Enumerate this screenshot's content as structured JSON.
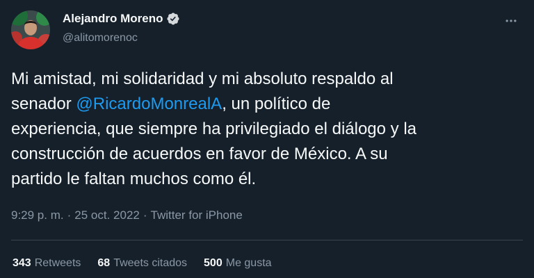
{
  "author": {
    "name": "Alejandro Moreno",
    "handle": "@alitomorenoc",
    "verified": true,
    "avatar_icon": "profile-photo"
  },
  "more_icon": "more-dots-icon",
  "tweet": {
    "lines": [
      [
        {
          "text": "Mi amistad, mi solidaridad y mi absoluto respaldo al"
        }
      ],
      [
        {
          "text": "senador "
        },
        {
          "text": "@RicardoMonrealA",
          "mention": true
        },
        {
          "text": ", un político de"
        }
      ],
      [
        {
          "text": "experiencia, que siempre ha privilegiado el diálogo y la"
        }
      ],
      [
        {
          "text": "construcción de acuerdos en favor de México. A su"
        }
      ],
      [
        {
          "text": "partido le faltan muchos como él."
        }
      ]
    ]
  },
  "meta": {
    "time": "9:29 p. m.",
    "separator": "·",
    "date": "25 oct. 2022",
    "source": "Twitter for iPhone"
  },
  "stats": [
    {
      "count": "343",
      "label": "Retweets"
    },
    {
      "count": "68",
      "label": "Tweets citados"
    },
    {
      "count": "500",
      "label": "Me gusta"
    }
  ],
  "colors": {
    "background": "#15202b",
    "text": "#f7f9f9",
    "muted": "#8b98a5",
    "accent": "#1d9bf0",
    "divider": "#38444d"
  }
}
